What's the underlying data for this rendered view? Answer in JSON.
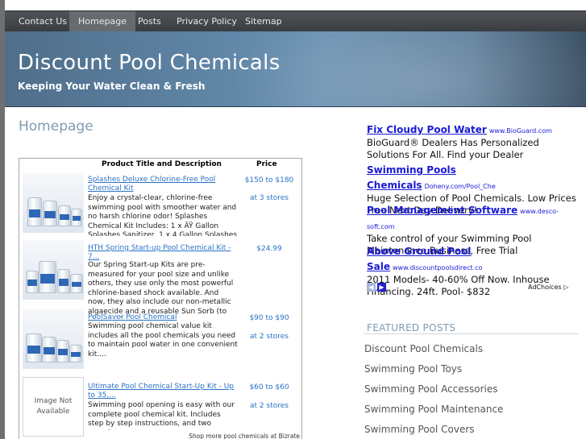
{
  "nav": [
    "Contact Us",
    "Homepage",
    "Posts",
    "Privacy Policy",
    "Sitemap"
  ],
  "site": {
    "title": "Discount Pool Chemicals",
    "tagline": "Keeping Your Water Clean & Fresh"
  },
  "page_title": "Homepage",
  "table": {
    "header_title": "Product Title and Description",
    "header_price": "Price",
    "shop_more": "Shop more pool chemicals at Bizrate",
    "products": [
      {
        "title": "Splashes Deluxe Chlorine-Free Pool Chemical Kit",
        "desc": "Enjoy a crystal-clear, chlorine-free swimming pool with smoother water and no harsh chlorine odor! Splashes Chemical Kit Includes: 1 x ÂŸ Gallon Splashes Sanitizer, 1 x 4 Gallon Splashes Shock & Oxidizer and 1 x 1 Quart Splashes Algaecide....",
        "price": "$150 to $180",
        "stores": "at 3 stores"
      },
      {
        "title": "HTH Spring Start-up Pool Chemical Kit - 7...",
        "desc": "Our Spring Start-up Kits are pre-measured for your pool size and unlike others, they use only the most powerful chlorine-based shock available. And now, they also include our non-metallic algaecide and a reusable Sun Sorb (to absorb oils in your pool....",
        "price": "$24.99",
        "stores": ""
      },
      {
        "title": "PoolSaver Pool Chemical",
        "desc": "Swimming pool chemical value kit includes all the pool chemicals you need to maintain pool water in one convenient kit....",
        "price": "$90 to $90",
        "stores": "at 2 stores"
      },
      {
        "title": "Ultimate Pool Chemical Start-Up Kit - Up to 35,...",
        "desc": "Swimming pool opening is easy with our complete pool chemical kit. Includes step by step instructions, and two complete ...",
        "price": "$60 to $60",
        "stores": "at 2 stores",
        "image_text": "Image Not Available"
      }
    ]
  },
  "ads": [
    {
      "title": "Fix Cloudy Pool Water",
      "url": "www.BioGuard.com",
      "text": "BioGuard® Dealers Has Personalized Solutions For All. Find your Dealer"
    },
    {
      "title": "Swimming Pools Chemicals",
      "url": "Doheny.com/Pool_Che",
      "text": "Huge Selection of Pool Chemicals. Low Prices Free Next Day Delivery!"
    },
    {
      "title": "Pool Management Software",
      "url": "www.desco-soft.com",
      "text": "Take control of your Swimming Pool Maintenance Business, Free Trial"
    },
    {
      "title": "Above Ground Pool Sale",
      "url": "www.discountpoolsdirect.co",
      "text": "2011 Models- 40-60% Off Now. Inhouse Financing. 24ft. Pool- $832"
    }
  ],
  "ad_choices": "AdChoices ▷",
  "featured": {
    "heading": "FEATURED POSTS",
    "items": [
      "Discount Pool Chemicals",
      "Swimming Pool Toys",
      "Swimming Pool Accessories",
      "Swimming Pool Maintenance",
      "Swimming Pool Covers"
    ]
  },
  "colors": {
    "nav_bg": "#45494c",
    "banner": "#5f84a5",
    "link": "#2a72c6",
    "ad_link": "#1a1ad6",
    "accent": "#7f9bb3"
  }
}
